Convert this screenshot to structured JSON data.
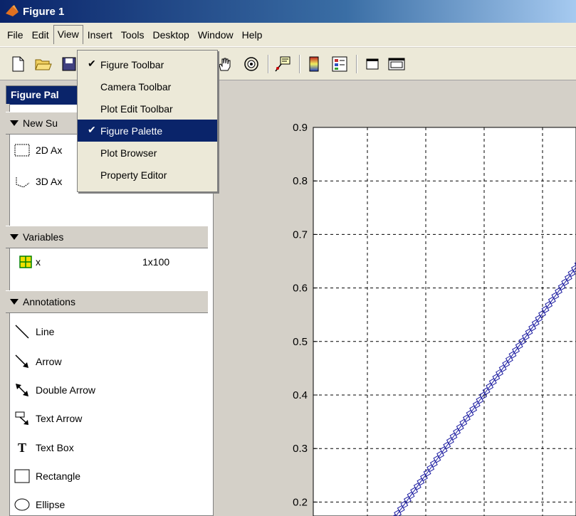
{
  "window": {
    "title": "Figure 1"
  },
  "menubar": {
    "items": [
      "File",
      "Edit",
      "View",
      "Insert",
      "Tools",
      "Desktop",
      "Window",
      "Help"
    ],
    "open_index": 2
  },
  "view_menu": {
    "items": [
      {
        "label": "Figure Toolbar",
        "checked": true,
        "highlighted": false
      },
      {
        "label": "Camera Toolbar",
        "checked": false,
        "highlighted": false
      },
      {
        "label": "Plot Edit Toolbar",
        "checked": false,
        "highlighted": false
      },
      {
        "label": "Figure Palette",
        "checked": true,
        "highlighted": true
      },
      {
        "label": "Plot Browser",
        "checked": false,
        "highlighted": false
      },
      {
        "label": "Property Editor",
        "checked": false,
        "highlighted": false
      }
    ]
  },
  "palette": {
    "title": "Figure Pal",
    "new_subplots": {
      "header": "New Su",
      "items": [
        "2D Ax",
        "3D Ax"
      ]
    },
    "variables": {
      "header": "Variables",
      "rows": [
        {
          "name": "x",
          "size": "1x100"
        }
      ]
    },
    "annotations": {
      "header": "Annotations",
      "items": [
        "Line",
        "Arrow",
        "Double Arrow",
        "Text Arrow",
        "Text Box",
        "Rectangle",
        "Ellipse"
      ]
    }
  },
  "chart_data": {
    "type": "line",
    "y_ticks": [
      "0.9",
      "0.8",
      "0.7",
      "0.6",
      "0.5",
      "0.4",
      "0.3",
      "0.2"
    ],
    "ylim": [
      0.2,
      0.9
    ],
    "grid": "dashed",
    "series": [
      {
        "marker": "square",
        "color": "#1a1aa0",
        "points": [
          [
            0.0,
            0.17
          ],
          [
            0.1,
            0.22
          ],
          [
            0.2,
            0.27
          ],
          [
            0.3,
            0.32
          ],
          [
            0.4,
            0.37
          ],
          [
            0.5,
            0.42
          ],
          [
            0.6,
            0.47
          ],
          [
            0.7,
            0.52
          ],
          [
            0.8,
            0.57
          ],
          [
            0.9,
            0.62
          ],
          [
            1.0,
            0.67
          ]
        ]
      }
    ]
  },
  "colors": {
    "title_bar": "#0a246a",
    "highlight": "#0a246a",
    "chrome": "#d4d0c8",
    "series": "#1a1aa0"
  }
}
